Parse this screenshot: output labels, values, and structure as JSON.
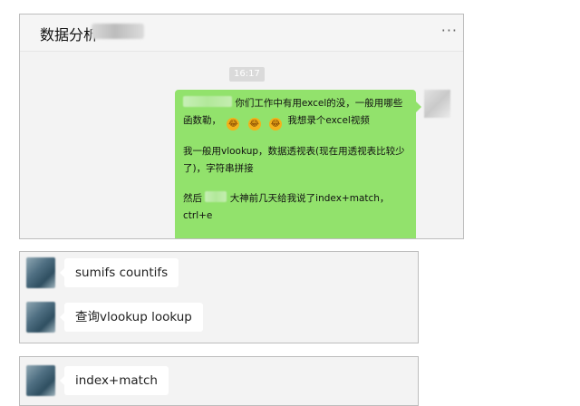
{
  "chat": {
    "title": "数据分析",
    "more_icon": "more-horizontal-icon",
    "timestamp": "16:17",
    "message": {
      "line1_suffix": "你们工作中有用excel的没，一般用哪些函数勒，",
      "line1_end": "我想录个excel视频",
      "emoji": "face-with-tears-of-joy",
      "line2": "我一般用vlookup，数据透视表(现在用透视表比较少了)，字符串拼接",
      "line3_prefix": "然后",
      "line3_suffix": "大神前几天给我说了index+match，ctrl+e"
    }
  },
  "replies": [
    {
      "text": "sumifs countifs"
    },
    {
      "text": "查询vlookup lookup"
    },
    {
      "text": "index+match"
    }
  ]
}
